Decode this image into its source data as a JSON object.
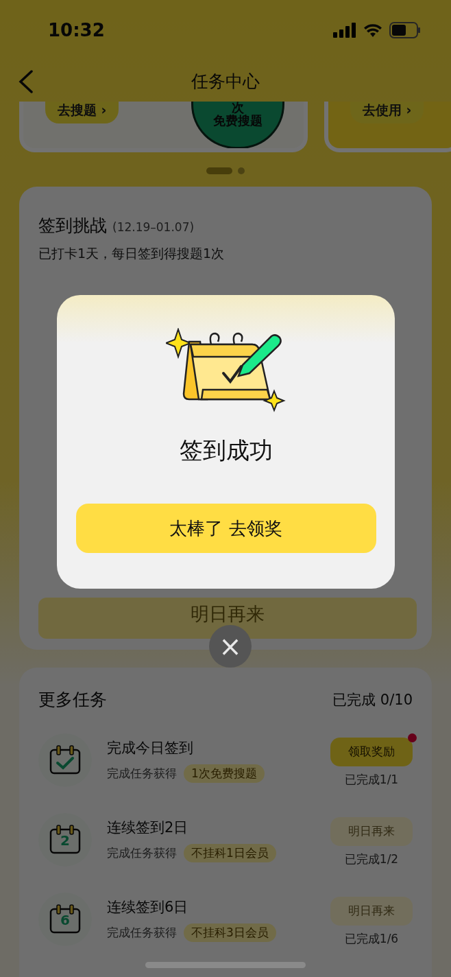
{
  "status_bar": {
    "time": "10:32"
  },
  "nav": {
    "title": "任务中心"
  },
  "carousel": {
    "cards": [
      {
        "button": "去搜题 ›",
        "stamp_top": "次",
        "stamp_text": "免费搜题"
      },
      {
        "button": "去使用 ›"
      }
    ],
    "pages": [
      {
        "selected": true
      },
      {
        "selected": false
      }
    ]
  },
  "checkin": {
    "title": "签到挑战",
    "period": "(12.19–01.07)",
    "subtitle": "已打卡1天，每日签到得搜题1次",
    "button": "明日再来"
  },
  "more_tasks": {
    "title": "更多任务",
    "progress": "已完成 0/10",
    "tasks": [
      {
        "kind": "check",
        "title": "完成今日签到",
        "reward_label": "完成任务获得",
        "reward": "1次免费搜题",
        "button": "领取奖励",
        "disabled": false,
        "badge": true,
        "done": "已完成1/1"
      },
      {
        "kind": "number",
        "icon_label": "2",
        "title": "连续签到2日",
        "reward_label": "完成任务获得",
        "reward": "不挂科1日会员",
        "button": "明日再来",
        "disabled": true,
        "badge": false,
        "done": "已完成1/2"
      },
      {
        "kind": "number",
        "icon_label": "6",
        "title": "连续签到6日",
        "reward_label": "完成任务获得",
        "reward": "不挂科3日会员",
        "button": "明日再来",
        "disabled": true,
        "badge": false,
        "done": "已完成1/6"
      }
    ]
  },
  "dialog": {
    "title": "签到成功",
    "button": "太棒了 去领奖",
    "close": "×"
  }
}
